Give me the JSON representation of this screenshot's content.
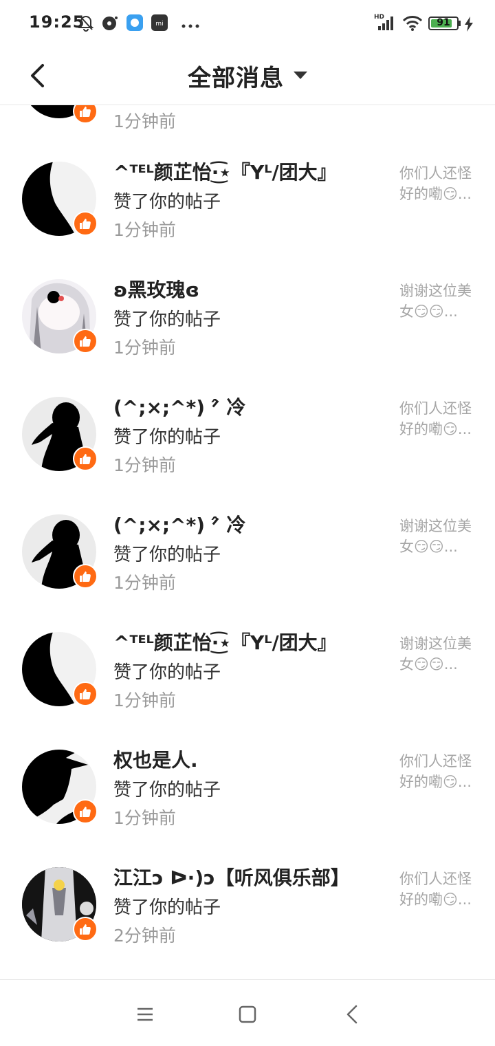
{
  "status_bar": {
    "time": "19:25",
    "icons_left": [
      "bell-off-icon",
      "disc-icon",
      "app-icon",
      "mi-icon",
      "more-dots-icon"
    ],
    "network_label": "HD",
    "battery_level": "91"
  },
  "header": {
    "title": "全部消息",
    "back_icon": "chevron-left-icon",
    "dropdown_icon": "caret-down-icon"
  },
  "messages": [
    {
      "name": "",
      "action": "",
      "time": "1分钟前",
      "quote": ""
    },
    {
      "name": "^ᵀᴱᴸ颜芷怡·͜͡⋆『Yᴸ/团大』",
      "action": "赞了你的帖子",
      "time": "1分钟前",
      "quote": "你们人还怪好的嘞😏..."
    },
    {
      "name": "ʚ黑玫瑰ɞ",
      "action": "赞了你的帖子",
      "time": "1分钟前",
      "quote": "谢谢这位美女😏😏..."
    },
    {
      "name": "(^;×;^*) ᐟ̂ 冷",
      "action": "赞了你的帖子",
      "time": "1分钟前",
      "quote": "你们人还怪好的嘞😏..."
    },
    {
      "name": "(^;×;^*) ᐟ̂ 冷",
      "action": "赞了你的帖子",
      "time": "1分钟前",
      "quote": "谢谢这位美女😏😏..."
    },
    {
      "name": "^ᵀᴱᴸ颜芷怡·͜͡⋆『Yᴸ/团大』",
      "action": "赞了你的帖子",
      "time": "1分钟前",
      "quote": "谢谢这位美女😏😏..."
    },
    {
      "name": "权也是人.",
      "action": "赞了你的帖子",
      "time": "1分钟前",
      "quote": "你们人还怪好的嘞😏..."
    },
    {
      "name": "江江ↄ ᐅ·)ↄ【听风俱乐部】",
      "action": "赞了你的帖子",
      "time": "2分钟前",
      "quote": "你们人还怪好的嘞😏..."
    }
  ],
  "badge_icon": "thumbs-up-icon",
  "bottom_nav": {
    "menu_icon": "menu-icon",
    "home_icon": "square-home-icon",
    "back_icon": "triangle-back-icon"
  },
  "colors": {
    "badge": "#ff6a13",
    "name": "#222222",
    "time": "#9a9a9a",
    "quote": "#a5a5a5",
    "battery": "#4caf50"
  }
}
